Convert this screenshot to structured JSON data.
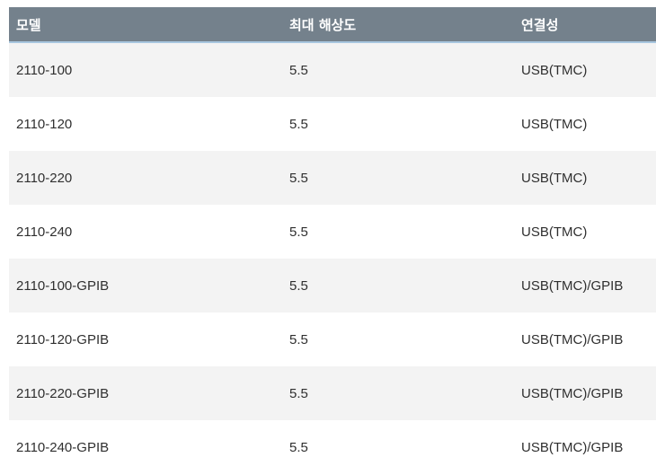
{
  "table": {
    "headers": [
      "모델",
      "최대 해상도",
      "연결성"
    ],
    "rows": [
      [
        "2110-100",
        "5.5",
        "USB(TMC)"
      ],
      [
        "2110-120",
        "5.5",
        "USB(TMC)"
      ],
      [
        "2110-220",
        "5.5",
        "USB(TMC)"
      ],
      [
        "2110-240",
        "5.5",
        "USB(TMC)"
      ],
      [
        "2110-100-GPIB",
        "5.5",
        "USB(TMC)/GPIB"
      ],
      [
        "2110-120-GPIB",
        "5.5",
        "USB(TMC)/GPIB"
      ],
      [
        "2110-220-GPIB",
        "5.5",
        "USB(TMC)/GPIB"
      ],
      [
        "2110-240-GPIB",
        "5.5",
        "USB(TMC)/GPIB"
      ]
    ]
  },
  "colors": {
    "header_bg": "#74818c",
    "header_border": "#a8c6df",
    "row_alt_bg": "#f3f3f3"
  }
}
